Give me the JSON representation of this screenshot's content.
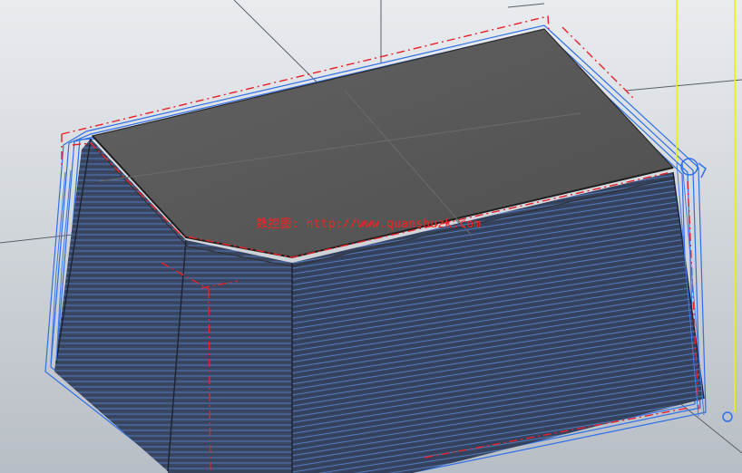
{
  "viewport": {
    "background_top": "#e9ecef",
    "background_bottom": "#b8bec5",
    "grid_color": "#5a5f66",
    "top_face_color": "#5d5d5d",
    "side_face_color": "#3d4a63",
    "toolpath_color": "#2f6fe8",
    "boundary_color": "#e8202a",
    "tool_axis_color": "#f0f000"
  },
  "watermark": {
    "text": "数控图: http://www.quanshuzk.com"
  }
}
